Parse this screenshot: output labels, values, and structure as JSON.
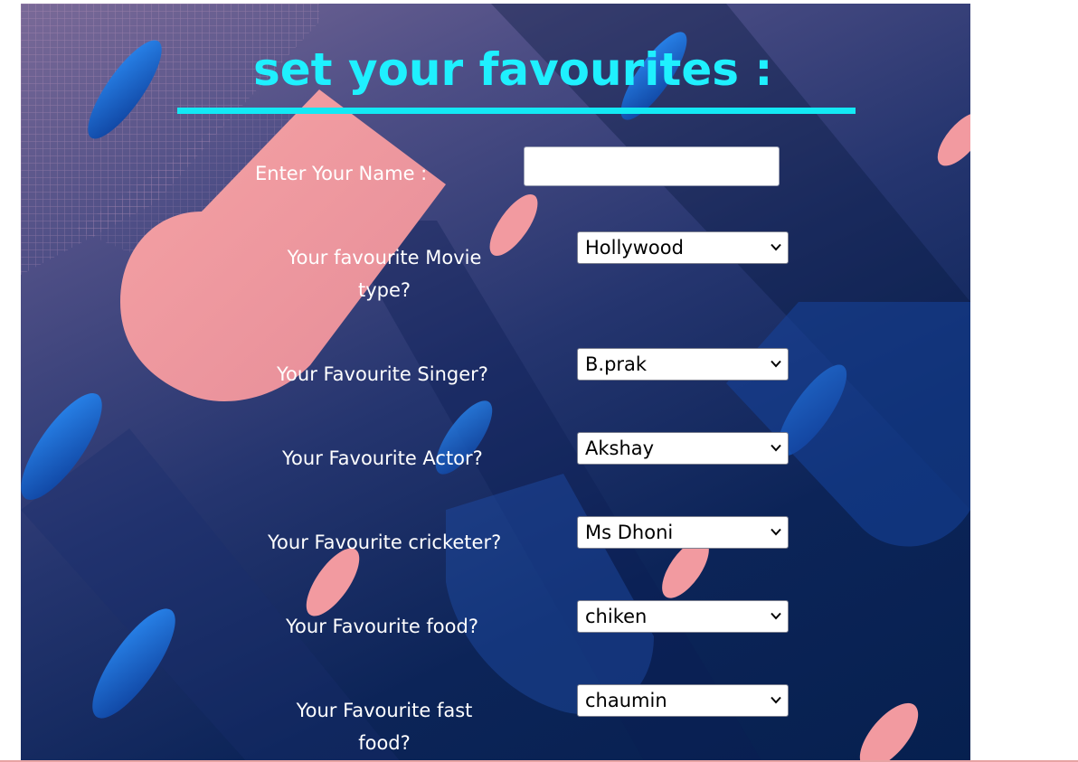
{
  "colors": {
    "title": "#1ff0ff",
    "underline": "#13e9f5",
    "label": "#ffffff",
    "panel_dark": "#06204f",
    "panel_light": "#7a6a98",
    "accent_pink": "#f19a9a",
    "accent_blue": "#1c6fe0"
  },
  "form": {
    "title": "set your favourites :",
    "name_label": "Enter Your Name :",
    "name_value": "",
    "fields": [
      {
        "label": "Your favourite Movie type?",
        "selected": "Hollywood"
      },
      {
        "label": "Your Favourite Singer?",
        "selected": "B.prak"
      },
      {
        "label": "Your Favourite Actor?",
        "selected": "Akshay"
      },
      {
        "label": "Your Favourite cricketer?",
        "selected": "Ms Dhoni"
      },
      {
        "label": "Your Favourite food?",
        "selected": "chiken"
      },
      {
        "label": "Your Favourite fast food?",
        "selected": "chaumin"
      }
    ]
  },
  "icons": {
    "dropdown": "chevron-down-icon"
  }
}
